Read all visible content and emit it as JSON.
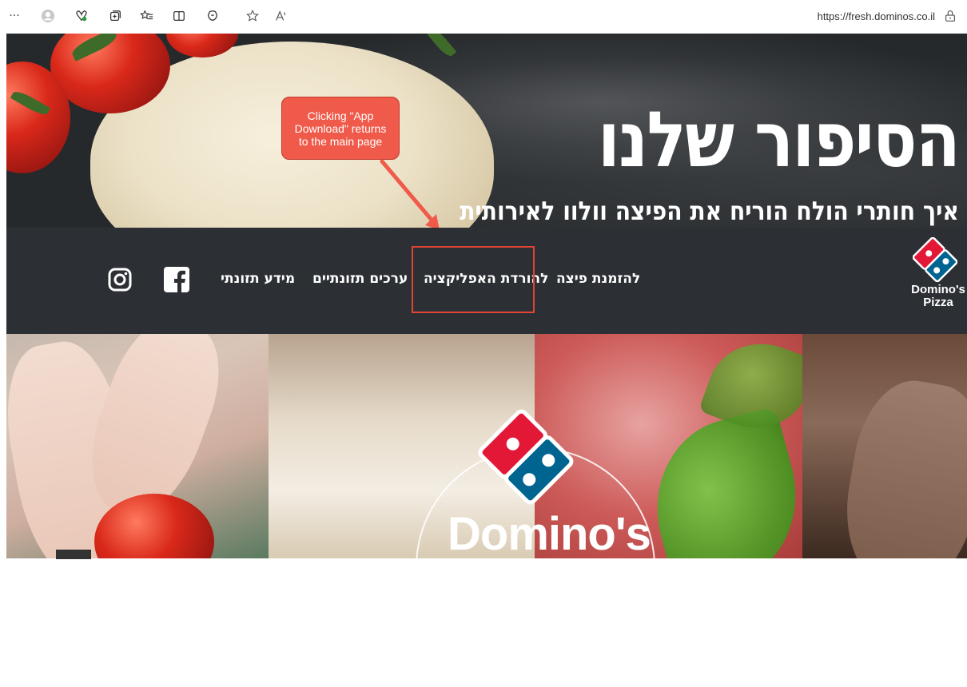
{
  "browser": {
    "url": "https://fresh.dominos.co.il",
    "more_glyph": "···"
  },
  "hero": {
    "title": "הסיפור שלנו",
    "subtitle": "איך חותרי הולח הוריח את הפיצה וולוו לאירותית"
  },
  "callout": {
    "text": "Clicking \"App Download\" returns to the main page",
    "color": "#f05a4a"
  },
  "nav": {
    "items": [
      {
        "label": "להזמנת פיצה"
      },
      {
        "label": "להורדת האפליקציה"
      },
      {
        "label": "ערכים תזונתיים"
      },
      {
        "label": "מידע תזונתי"
      }
    ],
    "logo_line1": "Domino's",
    "logo_line2": "Pizza",
    "background": "#2c3035",
    "highlight_color": "#e04434"
  },
  "promo": {
    "brand_word": "Domino's"
  },
  "colors": {
    "domino_red": "#e31837",
    "domino_blue": "#006491"
  }
}
